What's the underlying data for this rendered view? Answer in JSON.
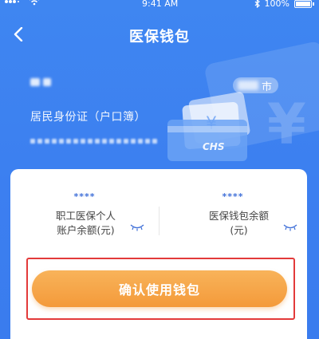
{
  "status_bar": {
    "time": "9:41 AM",
    "battery": "100%",
    "icons": [
      "signal-icon",
      "wifi-icon",
      "bluetooth-icon",
      "battery-icon"
    ]
  },
  "header": {
    "title": "医保钱包",
    "back_icon": "chevron-left-icon"
  },
  "identity": {
    "id_type": "居民身份证（户口簿）",
    "city_suffix": "市"
  },
  "balances": [
    {
      "value": "****",
      "label_line1": "职工医保个人",
      "label_line2": "账户余额(元)",
      "eye_icon": "eye-closed-icon"
    },
    {
      "value": "****",
      "label_line1": "医保钱包余额",
      "label_line2": "(元)",
      "eye_icon": "eye-closed-icon"
    }
  ],
  "confirm": {
    "label": "确认使用钱包"
  },
  "decoration": {
    "card_logo": "CHS"
  },
  "colors": {
    "background": "#3c7ff0",
    "accent_orange": "#f49a3a",
    "highlight_red": "#e33a3a",
    "masked_value_blue": "#3f6fd8"
  }
}
